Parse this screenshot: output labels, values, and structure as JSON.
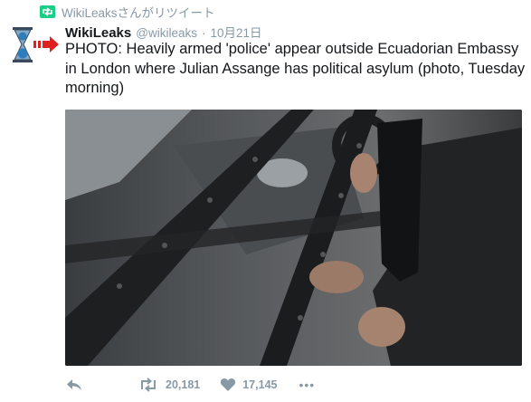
{
  "retweet_context": {
    "text": "WikiLeaksさんがリツイート",
    "icon": "retweet-badge-icon",
    "accent": "#19cf86"
  },
  "tweet": {
    "author_name": "WikiLeaks",
    "handle": "@wikileaks",
    "separator": "·",
    "date": "10月21日",
    "text": "PHOTO: Heavily armed 'police' appear outside Ecuadorian Embassy in London where Julian Assange has political asylum (photo, Tuesday morning)",
    "avatar_icon": "wikileaks-hourglass-icon",
    "arrow_icon": "red-arrow-icon",
    "arrow_color": "#e02020",
    "photo_alt": "armed-officer-in-vehicle-photo"
  },
  "actions": {
    "reply_icon": "reply-icon",
    "retweet_icon": "retweet-icon",
    "retweet_count": "20,181",
    "like_icon": "heart-icon",
    "like_count": "17,145",
    "more_label": "•••"
  }
}
